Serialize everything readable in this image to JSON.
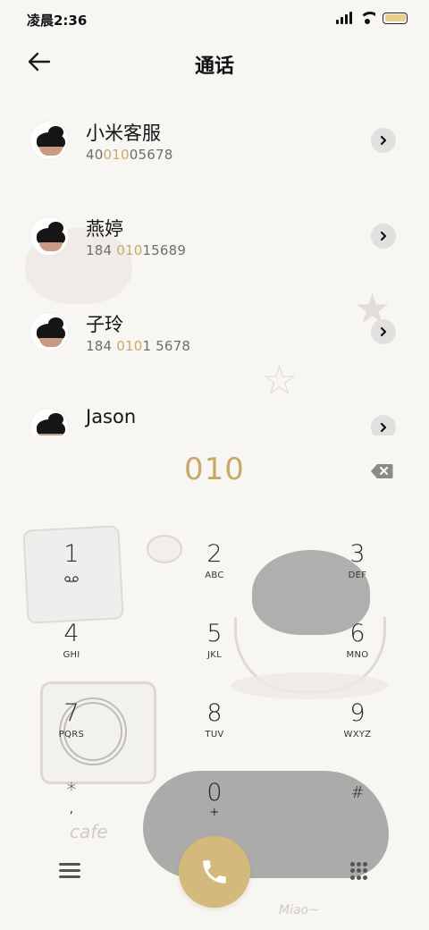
{
  "status_bar": {
    "time": "凌晨2:36",
    "icons": [
      "signal-icon",
      "wifi-icon",
      "battery-icon"
    ]
  },
  "header": {
    "title": "通话",
    "back_icon": "arrow-left-icon"
  },
  "contacts": [
    {
      "name": "小米客服",
      "number_pre": "40",
      "number_match": "010",
      "number_post": "05678"
    },
    {
      "name": "燕婷",
      "number_pre": "184 ",
      "number_match": "010",
      "number_post": "15689"
    },
    {
      "name": "子玲",
      "number_pre": "184 ",
      "number_match": "010",
      "number_post": "1 5678"
    },
    {
      "name": "Jason",
      "number_pre": "",
      "number_match": "",
      "number_post": ""
    }
  ],
  "dialer": {
    "input": "010",
    "keys": [
      {
        "digit": "1",
        "letters": ""
      },
      {
        "digit": "2",
        "letters": "ABC"
      },
      {
        "digit": "3",
        "letters": "DEF"
      },
      {
        "digit": "4",
        "letters": "GHI"
      },
      {
        "digit": "5",
        "letters": "JKL"
      },
      {
        "digit": "6",
        "letters": "MNO"
      },
      {
        "digit": "7",
        "letters": "PQRS"
      },
      {
        "digit": "8",
        "letters": "TUV"
      },
      {
        "digit": "9",
        "letters": "WXYZ"
      },
      {
        "digit": "*",
        "letters": ","
      },
      {
        "digit": "0",
        "letters": "+"
      },
      {
        "digit": "#",
        "letters": ""
      }
    ]
  },
  "colors": {
    "accent": "#c8a96a",
    "call_button": "#d3b97b",
    "background": "#f7f6f3"
  },
  "decor": {
    "text_cafe": "cafe",
    "text_miao": "Miao~"
  }
}
